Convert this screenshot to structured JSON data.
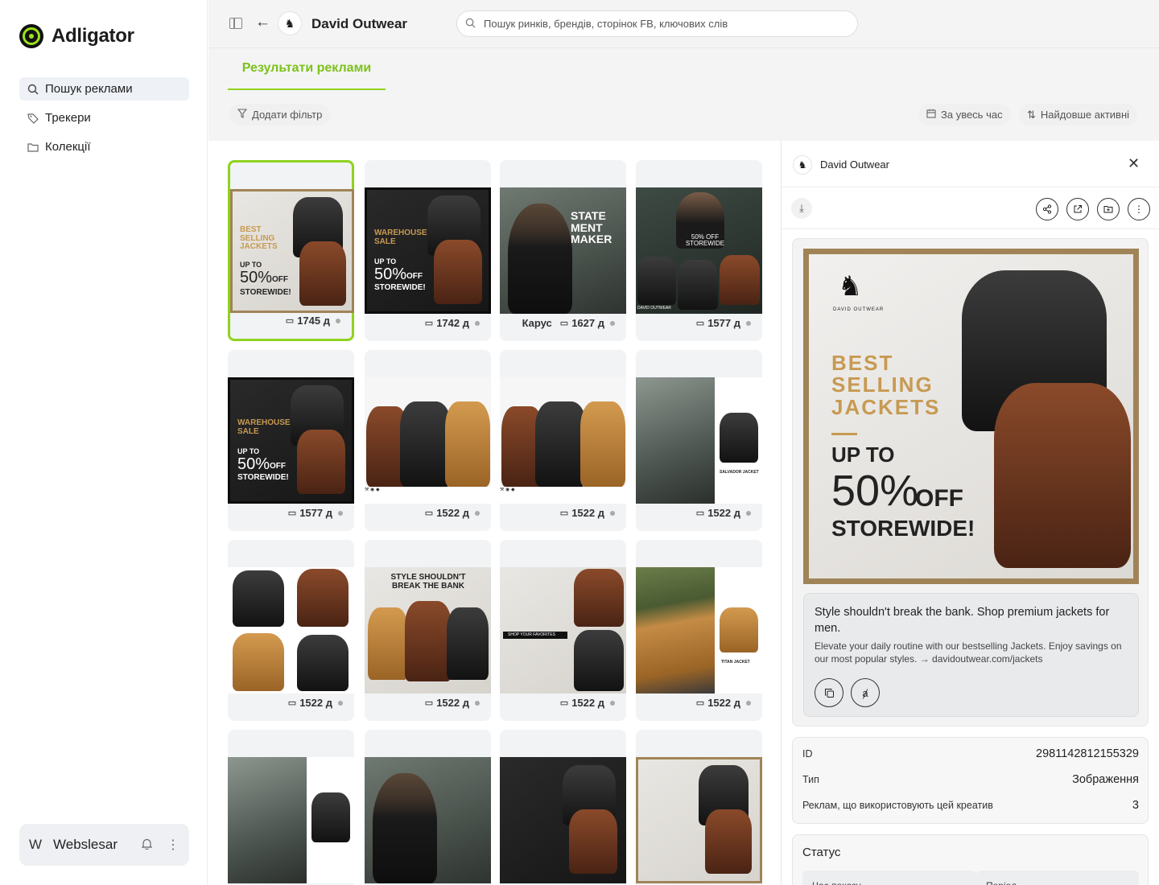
{
  "app": {
    "name": "Adligator"
  },
  "sidebar": {
    "items": [
      {
        "label": "Пошук реклами",
        "icon": "search-icon",
        "active": true
      },
      {
        "label": "Трекери",
        "icon": "tag-icon",
        "active": false
      },
      {
        "label": "Колекції",
        "icon": "folder-icon",
        "active": false
      }
    ],
    "user": {
      "initial": "W",
      "name": "Webslesar"
    }
  },
  "topbar": {
    "brand": "David Outwear",
    "search_placeholder": "Пошук ринків, брендів, сторінок FB, ключових слів"
  },
  "tabs": {
    "results_label": "Результати реклами"
  },
  "filters": {
    "add_filter": "Додати фільтр",
    "date_range": "За увесь час",
    "sort": "Найдовше активні"
  },
  "ads": [
    {
      "days": "1745 д",
      "carousel": ""
    },
    {
      "days": "1742 д",
      "carousel": ""
    },
    {
      "days": "1627 д",
      "carousel": "Карус"
    },
    {
      "days": "1577 д",
      "carousel": ""
    },
    {
      "days": "1577 д",
      "carousel": ""
    },
    {
      "days": "1522 д",
      "carousel": ""
    },
    {
      "days": "1522 д",
      "carousel": ""
    },
    {
      "days": "1522 д",
      "carousel": ""
    },
    {
      "days": "1522 д",
      "carousel": ""
    },
    {
      "days": "1522 д",
      "carousel": ""
    },
    {
      "days": "1522 д",
      "carousel": ""
    },
    {
      "days": "1522 д",
      "carousel": ""
    }
  ],
  "creative_text": {
    "best_selling": "BEST SELLING JACKETS",
    "up_to": "UP TO",
    "fifty": "50%",
    "off": "OFF",
    "storewide": "STOREWIDE!",
    "warehouse": "WAREHOUSE SALE",
    "statement": "STATE MENT MAKER",
    "style": "STYLE SHOULDN'T BREAK THE BANK",
    "fifty_off_storewide": "50% OFF STOREWIDE",
    "david_outwear": "DAVID OUTWEAR",
    "salvador": "SALVADOR JACKET",
    "titan": "TITAN JACKET",
    "shop_favorites": "SHOP YOUR FAVORITES"
  },
  "detail": {
    "brand": "David Outwear",
    "ad_title": "Style shouldn't break the bank. Shop premium jackets for men.",
    "ad_body": "Elevate your daily routine with our bestselling Jackets. Enjoy savings on our most popular styles. → davidoutwear.com/jackets",
    "id_label": "ID",
    "id_value": "2981142812155329",
    "type_label": "Тип",
    "type_value": "Зображення",
    "uses_label": "Реклам, що використовують цей креатив",
    "uses_value": "3",
    "status_title": "Статус",
    "status_first": "Час показу",
    "status_second": "Період"
  },
  "colors": {
    "accent": "#8fd31f",
    "accent_text": "#7cc21a",
    "frame": "#a08457"
  }
}
